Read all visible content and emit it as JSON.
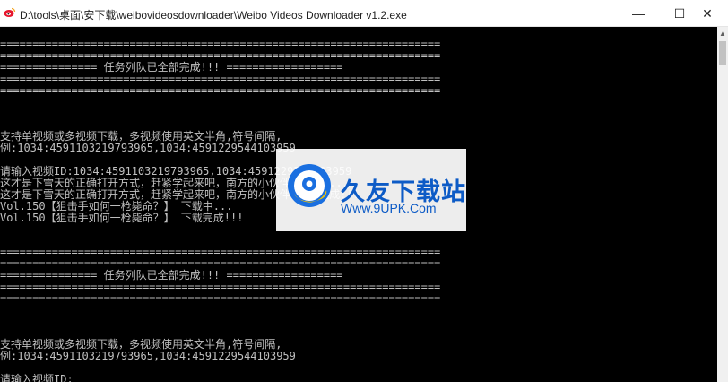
{
  "window": {
    "title": "D:\\tools\\桌面\\安下载\\weibovideosdownloader\\Weibo Videos Downloader v1.2.exe",
    "minimize_glyph": "—",
    "maximize_glyph": "☐",
    "close_glyph": "✕",
    "app_icon": "weibo-icon"
  },
  "console": {
    "lines": [
      "====================================================================",
      "====================================================================",
      "=============== 任务列队已全部完成!!! ==================",
      "====================================================================",
      "====================================================================",
      "",
      "",
      "",
      "支持单视频或多视频下载，多视频使用英文半角,符号间隔,",
      "例:1034:4591103219793965,1034:4591229544103959",
      "",
      "请输入视频ID:1034:4591103219793965,1034:4591229544103959",
      "这才是下雪天的正确打开方式，赶紧学起来吧，南方的小伙伴 下载中...",
      "这才是下雪天的正确打开方式，赶紧学起来吧，南方的小伙伴 下载完成!!!",
      "Vol.150【狙击手如何一枪毙命？】 下载中...",
      "Vol.150【狙击手如何一枪毙命？】 下载完成!!!",
      "",
      "",
      "====================================================================",
      "====================================================================",
      "=============== 任务列队已全部完成!!! ==================",
      "====================================================================",
      "====================================================================",
      "",
      "",
      "",
      "支持单视频或多视频下载，多视频使用英文半角,符号间隔,",
      "例:1034:4591103219793965,1034:4591229544103959",
      "",
      "请输入视频ID:_"
    ]
  },
  "watermark": {
    "title": "久友下载站",
    "url": "Www.9UPK.Com",
    "logo_icon": "9upk-logo-icon"
  },
  "colors": {
    "console_bg": "#000000",
    "console_text": "#c0c0c0",
    "watermark_blue": "#0d5bc6"
  }
}
